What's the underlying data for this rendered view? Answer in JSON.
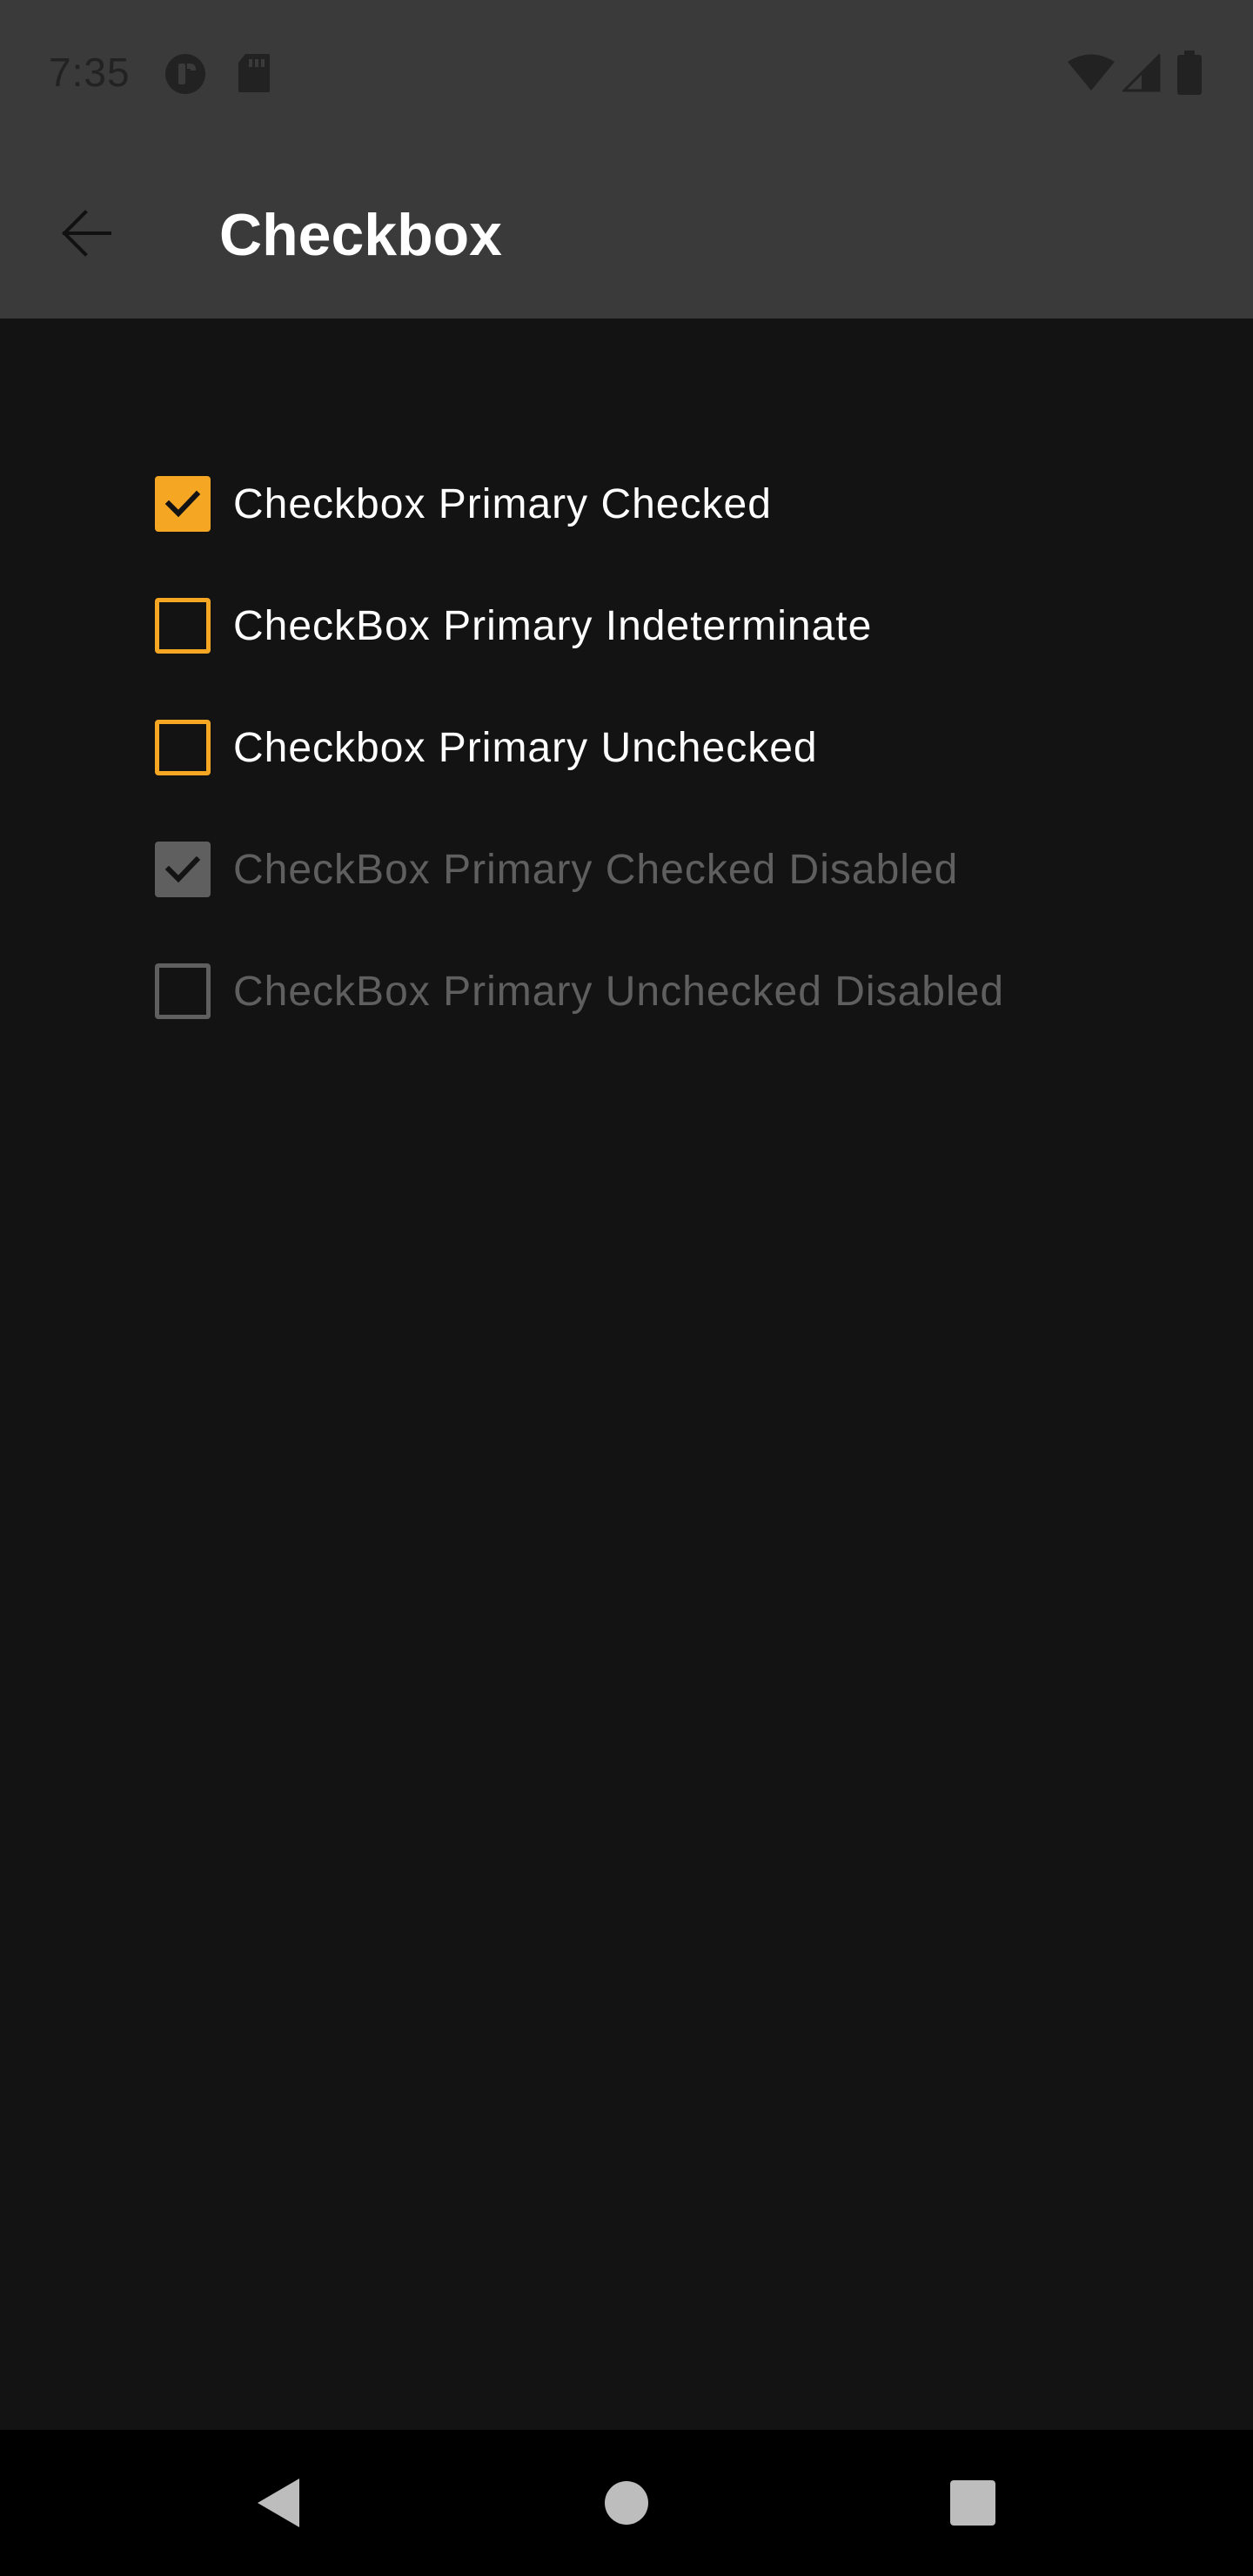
{
  "status_bar": {
    "time": "7:35",
    "left_icons": [
      "nfc-icon",
      "sd-card-icon"
    ],
    "right_icons": [
      "wifi-icon",
      "signal-icon",
      "battery-icon"
    ]
  },
  "app_bar": {
    "title": "Checkbox",
    "back_icon": "arrow-back-icon"
  },
  "colors": {
    "accent": "#F5A623",
    "enabled_text": "#FFFFFF",
    "disabled": "#5F5F5F",
    "background": "#131313",
    "bar": "#3A3A3A"
  },
  "checkboxes": [
    {
      "label": "Checkbox Primary Checked",
      "state": "checked",
      "disabled": false
    },
    {
      "label": "CheckBox Primary Indeterminate",
      "state": "indeterminate",
      "disabled": false
    },
    {
      "label": "Checkbox Primary Unchecked",
      "state": "unchecked",
      "disabled": false
    },
    {
      "label": "CheckBox Primary Checked Disabled",
      "state": "checked",
      "disabled": true
    },
    {
      "label": "CheckBox Primary Unchecked Disabled",
      "state": "unchecked",
      "disabled": true
    }
  ],
  "nav_bar": {
    "buttons": [
      "back-triangle-icon",
      "home-circle-icon",
      "recents-square-icon"
    ]
  }
}
